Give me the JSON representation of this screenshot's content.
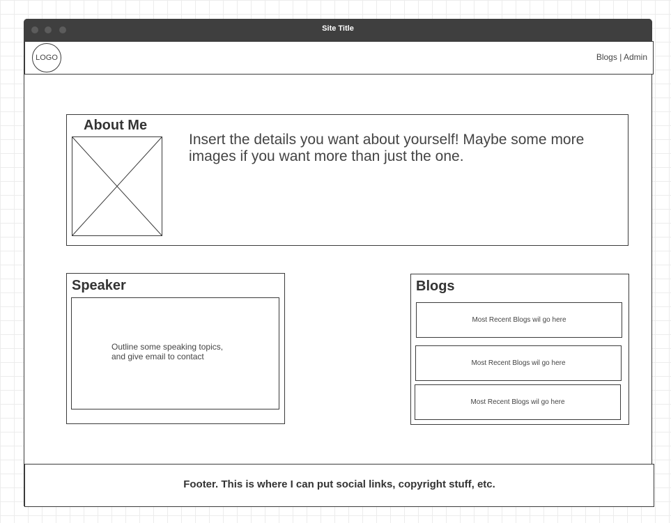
{
  "window": {
    "title": "Site Title"
  },
  "nav": {
    "logo": "LOGO",
    "links": [
      "Blogs",
      "Admin"
    ],
    "separator": "|"
  },
  "about": {
    "title": "About Me",
    "text": "Insert the details you want about yourself! Maybe some more images if you want more than just the one."
  },
  "speaker": {
    "title": "Speaker",
    "text_line1": "Outline some speaking topics,",
    "text_line2": "and give email to contact"
  },
  "blogs": {
    "title": "Blogs",
    "items": [
      "Most Recent Blogs wil go here",
      "Most Recent Blogs wil go here",
      "Most Recent Blogs wil go here"
    ]
  },
  "footer": {
    "text": "Footer. This is where I can put social links, copyright stuff, etc."
  },
  "colors": {
    "titlebar": "#3f3f3f",
    "border": "#3a3a3a",
    "text": "#333333"
  }
}
